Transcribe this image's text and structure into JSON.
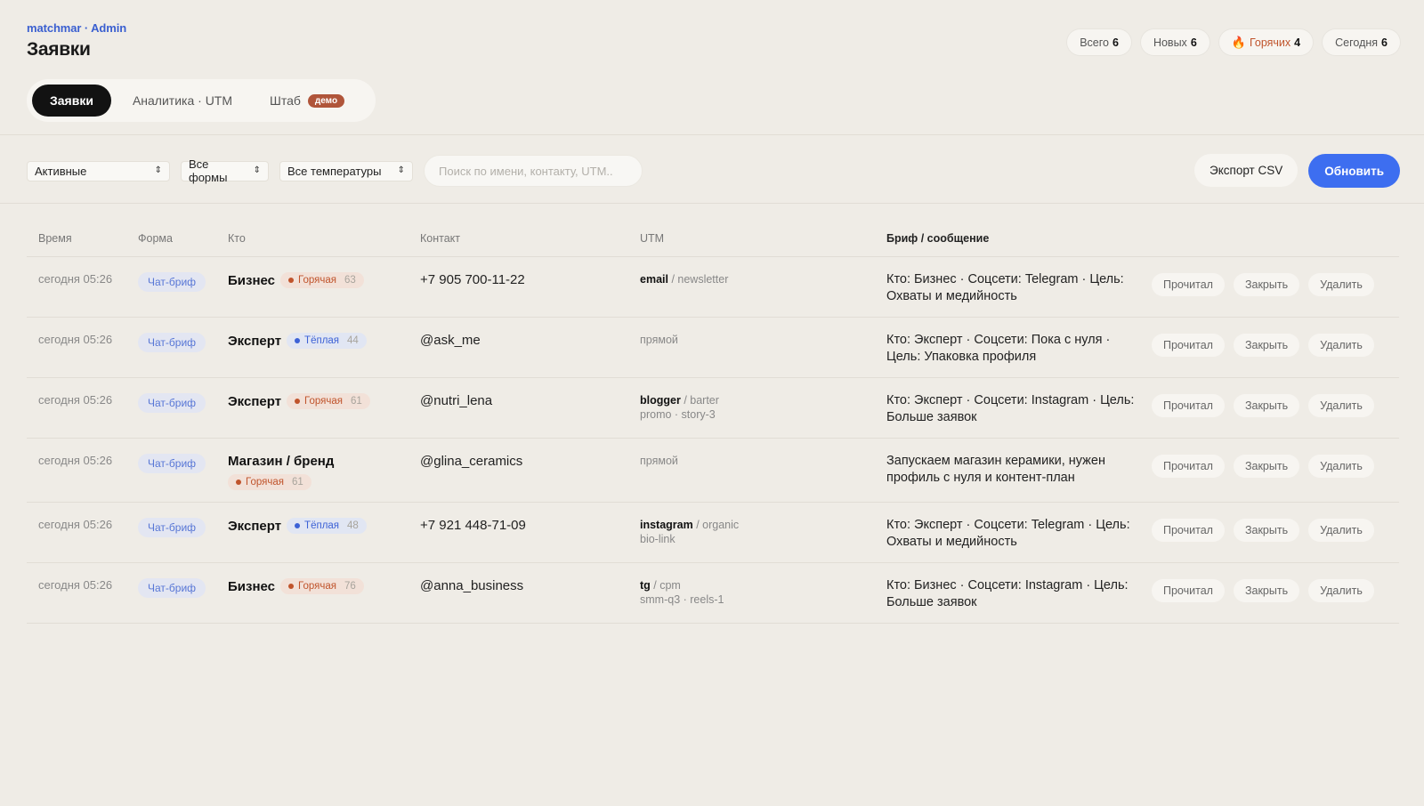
{
  "header": {
    "brand": "matchmar · Admin",
    "title": "Заявки"
  },
  "stats": [
    {
      "label": "Всего",
      "value": "6"
    },
    {
      "label": "Новых",
      "value": "6"
    },
    {
      "label": "Горячих",
      "value": "4",
      "icon": "flame-icon"
    },
    {
      "label": "Сегодня",
      "value": "6"
    }
  ],
  "tabs": [
    {
      "label": "Заявки",
      "active": true
    },
    {
      "label": "Аналитика · UTM",
      "active": false
    },
    {
      "label": "Штаб",
      "badge": "демо",
      "active": false
    }
  ],
  "filters": {
    "status": "Активные",
    "forms": "Все формы",
    "temperature": "Все температуры",
    "search_placeholder": "Поиск по имени, контакту, UTM..",
    "export_label": "Экспорт CSV",
    "refresh_label": "Обновить"
  },
  "colors": {
    "accent": "#3d6ef0",
    "hot": "#c0542c",
    "warm": "#3d62d6",
    "background": "#efece6"
  },
  "table": {
    "headers": {
      "time": "Время",
      "form": "Форма",
      "who": "Кто",
      "contact": "Контакт",
      "utm": "UTM",
      "brief": "Бриф / сообщение"
    },
    "row_actions": {
      "read": "Прочитал",
      "close": "Закрыть",
      "delete": "Удалить"
    },
    "rows": [
      {
        "time": "сегодня 05:26",
        "form": "Чат-бриф",
        "who": "Бизнес",
        "temp": "Горячая",
        "temp_kind": "hot",
        "score": "63",
        "contact": "+7 905 700-11-22",
        "utm_source": "email",
        "utm_medium": " / newsletter",
        "utm_extra": "",
        "brief": "Кто: Бизнес · Соцсети: Telegram · Цель: Охваты и медийность"
      },
      {
        "time": "сегодня 05:26",
        "form": "Чат-бриф",
        "who": "Эксперт",
        "temp": "Тёплая",
        "temp_kind": "warm",
        "score": "44",
        "contact": "@ask_me",
        "utm_source": "",
        "utm_medium": "прямой",
        "utm_extra": "",
        "brief": "Кто: Эксперт · Соцсети: Пока с нуля · Цель: Упаковка профиля"
      },
      {
        "time": "сегодня 05:26",
        "form": "Чат-бриф",
        "who": "Эксперт",
        "temp": "Горячая",
        "temp_kind": "hot",
        "score": "61",
        "contact": "@nutri_lena",
        "utm_source": "blogger",
        "utm_medium": " / barter",
        "utm_extra": "promo · story-3",
        "brief": "Кто: Эксперт · Соцсети: Instagram · Цель: Больше заявок"
      },
      {
        "time": "сегодня 05:26",
        "form": "Чат-бриф",
        "who": "Магазин / бренд",
        "temp": "Горячая",
        "temp_kind": "hot",
        "score": "61",
        "contact": "@glina_ceramics",
        "utm_source": "",
        "utm_medium": "прямой",
        "utm_extra": "",
        "brief": "Запускаем магазин керамики, нужен профиль с нуля и контент-план"
      },
      {
        "time": "сегодня 05:26",
        "form": "Чат-бриф",
        "who": "Эксперт",
        "temp": "Тёплая",
        "temp_kind": "warm",
        "score": "48",
        "contact": "+7 921 448-71-09",
        "utm_source": "instagram",
        "utm_medium": " / organic",
        "utm_extra": "bio-link",
        "brief": "Кто: Эксперт · Соцсети: Telegram · Цель: Охваты и медийность"
      },
      {
        "time": "сегодня 05:26",
        "form": "Чат-бриф",
        "who": "Бизнес",
        "temp": "Горячая",
        "temp_kind": "hot",
        "score": "76",
        "contact": "@anna_business",
        "utm_source": "tg",
        "utm_medium": " / cpm",
        "utm_extra": "smm-q3 · reels-1",
        "brief": "Кто: Бизнес · Соцсети: Instagram · Цель: Больше заявок"
      }
    ]
  }
}
